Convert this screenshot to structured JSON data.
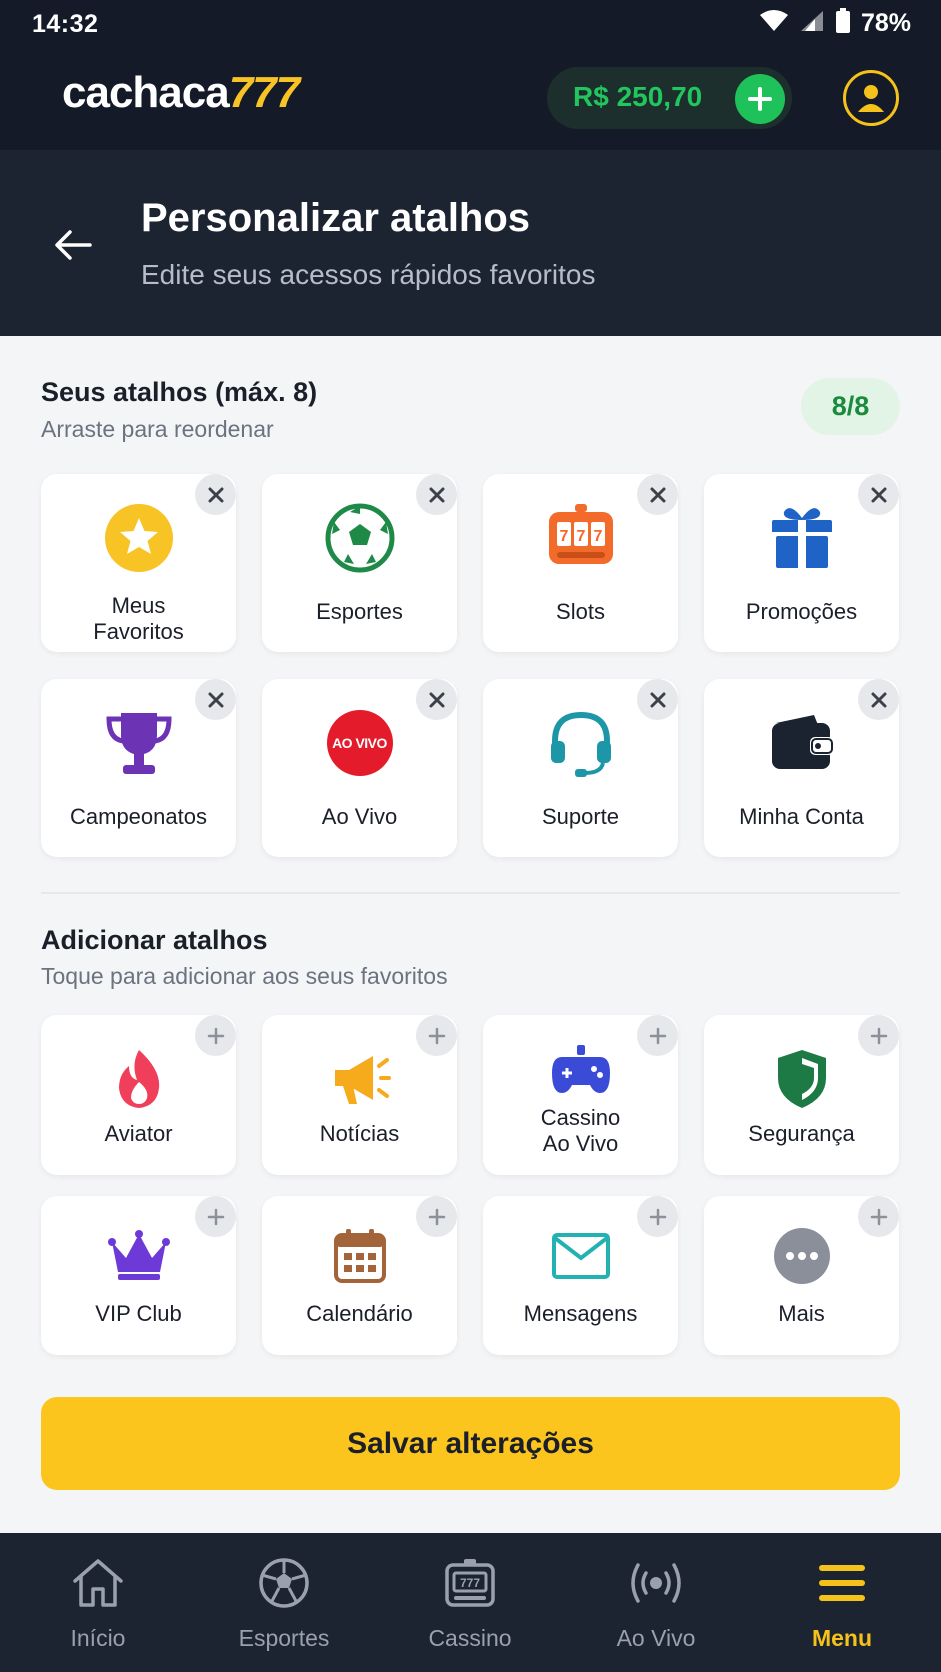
{
  "status_bar": {
    "time": "14:32",
    "battery": "78%"
  },
  "header": {
    "logo_text": "cachaca",
    "logo_number": "777",
    "balance": "R$ 250,70"
  },
  "page": {
    "title": "Personalizar atalhos",
    "subtitle": "Edite seus acessos rápidos favoritos"
  },
  "your_shortcuts": {
    "title": "Seus atalhos (máx. 8)",
    "subtitle": "Arraste para reordenar",
    "count": "8/8",
    "items": [
      {
        "line1": "Meus",
        "line2": "Favoritos",
        "icon": "star-icon"
      },
      {
        "line1": "Esportes",
        "line2": "",
        "icon": "soccer-ball-icon"
      },
      {
        "line1": "Slots",
        "line2": "",
        "icon": "slot-machine-icon"
      },
      {
        "line1": "Promoções",
        "line2": "",
        "icon": "gift-icon"
      },
      {
        "line1": "Campeonatos",
        "line2": "",
        "icon": "trophy-icon"
      },
      {
        "line1": "Ao Vivo",
        "line2": "",
        "icon": "live-badge-icon",
        "icon_text": "AO VIVO"
      },
      {
        "line1": "Suporte",
        "line2": "",
        "icon": "headset-icon"
      },
      {
        "line1": "Minha Conta",
        "line2": "",
        "icon": "wallet-icon"
      }
    ]
  },
  "add_shortcuts": {
    "title": "Adicionar atalhos",
    "subtitle": "Toque para adicionar aos seus favoritos",
    "items": [
      {
        "line1": "Aviator",
        "line2": "",
        "icon": "flame-icon"
      },
      {
        "line1": "Notícias",
        "line2": "",
        "icon": "megaphone-icon"
      },
      {
        "line1": "Cassino",
        "line2": "Ao Vivo",
        "icon": "gamepad-icon"
      },
      {
        "line1": "Segurança",
        "line2": "",
        "icon": "shield-icon"
      },
      {
        "line1": "VIP Club",
        "line2": "",
        "icon": "crown-icon"
      },
      {
        "line1": "Calendário",
        "line2": "",
        "icon": "calendar-icon"
      },
      {
        "line1": "Mensagens",
        "line2": "",
        "icon": "envelope-icon"
      },
      {
        "line1": "Mais",
        "line2": "",
        "icon": "more-dots-icon"
      }
    ]
  },
  "save_button": "Salvar alterações",
  "bottom_nav": [
    {
      "label": "Início",
      "icon": "home-icon",
      "active": false
    },
    {
      "label": "Esportes",
      "icon": "soccer-ball-icon",
      "active": false
    },
    {
      "label": "Cassino",
      "icon": "slot-machine-icon",
      "active": false
    },
    {
      "label": "Ao Vivo",
      "icon": "live-broadcast-icon",
      "active": false
    },
    {
      "label": "Menu",
      "icon": "hamburger-menu-icon",
      "active": true
    }
  ],
  "colors": {
    "brand_yellow": "#fbc51e",
    "balance_green": "#22c55e",
    "header_dark": "#141a27",
    "nav_dark": "#1c2331",
    "badge_green_bg": "#e2f4e6",
    "badge_green_text": "#1a8a3c"
  }
}
